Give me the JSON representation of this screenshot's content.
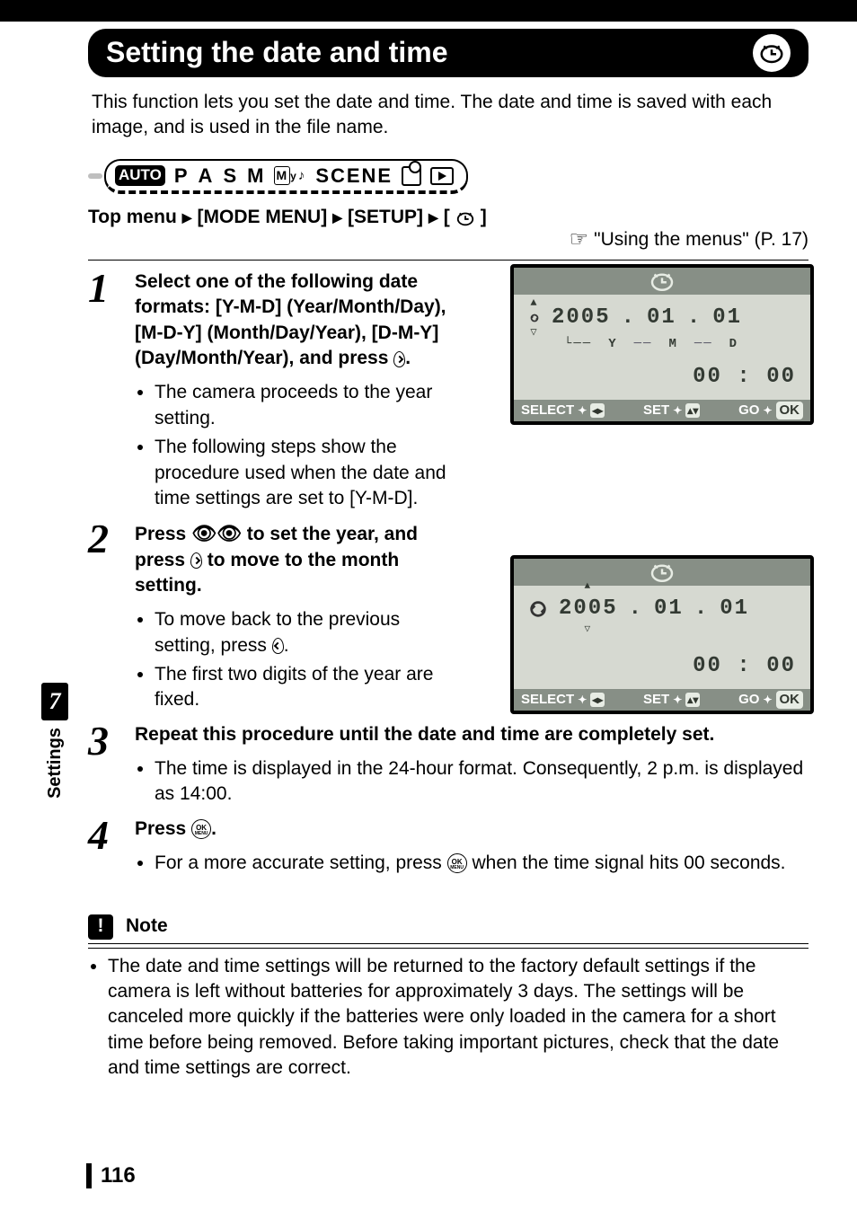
{
  "chapter": {
    "title": "Setting the date and time"
  },
  "intro": "This function lets you set the date and time. The date and time is saved with each image, and is used in the file name.",
  "modes": {
    "auto": "AUTO",
    "p": "P",
    "a": "A",
    "s": "S",
    "m": "M",
    "my_prefix": "M",
    "my_suffix": "y",
    "scene": "SCENE"
  },
  "breadcrumb": {
    "top": "Top menu",
    "item1": "[MODE MENU]",
    "item2": "[SETUP]",
    "open": "[",
    "close": "]"
  },
  "seealso": {
    "text": "Using the menus",
    "page": "(P. 17)"
  },
  "steps": {
    "s1": {
      "num": "1",
      "title_a": "Select one of the following date formats: [Y-M-D] (Year/Month/Day), [M-D-Y] (Month/Day/Year), [D-M-Y] (Day/Month/Year), and press ",
      "title_b": ".",
      "bullets": [
        "The camera proceeds to the year setting.",
        "The following steps show the procedure used when the date and time settings are set to [Y-M-D]."
      ]
    },
    "s2": {
      "num": "2",
      "title_a": "Press ",
      "title_b": " to set the year, and press ",
      "title_c": " to move to the month setting.",
      "bullets_a": "To move back to the previous setting, press ",
      "bullets_a2": ".",
      "bullets_b": "The first two digits of the year are fixed."
    },
    "s3": {
      "num": "3",
      "title": "Repeat this procedure until the date and time are completely set.",
      "bullets": [
        "The time is displayed in the 24-hour format. Consequently, 2 p.m. is displayed as 14:00."
      ]
    },
    "s4": {
      "num": "4",
      "title_a": "Press ",
      "title_b": ".",
      "bullets_a": "For a more accurate setting, press ",
      "bullets_b": " when the time signal hits 00 seconds."
    }
  },
  "note": {
    "heading": "Note",
    "body": "The date and time settings will be returned to the factory default settings if the camera is left without batteries for approximately 3 days. The settings will be canceled more quickly if the batteries were only loaded in the camera for a short time before being removed. Before taking important pictures, check that the date and time settings are correct."
  },
  "screen_a": {
    "year": "2005",
    "month": "01",
    "day": "01",
    "fmt_y": "Y",
    "fmt_m": "M",
    "fmt_d": "D",
    "time_h": "00",
    "time_m": "00",
    "select": "SELECT",
    "set": "SET",
    "go": "GO",
    "ok": "OK"
  },
  "screen_b": {
    "year": "2005",
    "month": "01",
    "day": "01",
    "time_h": "00",
    "time_m": "00",
    "select": "SELECT",
    "set": "SET",
    "go": "GO",
    "ok": "OK"
  },
  "sidetab": {
    "chapter": "7",
    "label": "Settings"
  },
  "ok_btn": {
    "top": "OK",
    "bottom": "MENU"
  },
  "pagenum": "116"
}
